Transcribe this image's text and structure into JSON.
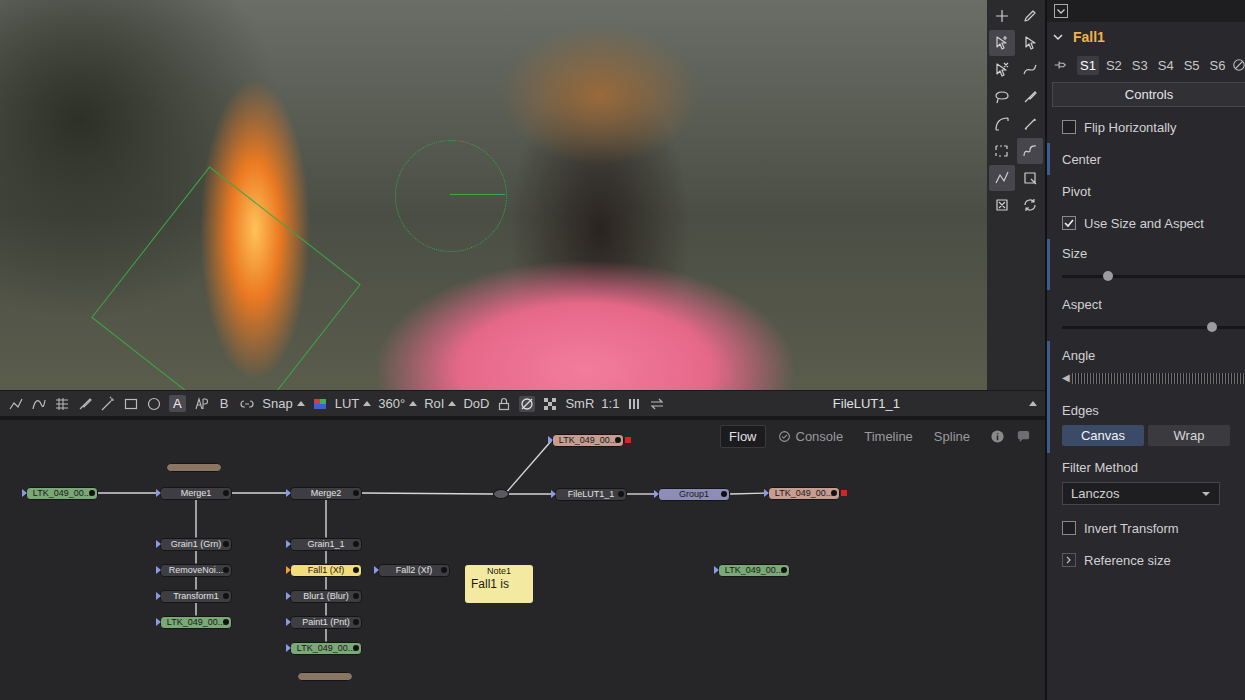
{
  "viewer_tools": [
    {
      "selected": false
    },
    {
      "selected": false
    },
    {
      "selected": true
    },
    {
      "selected": false
    },
    {
      "selected": false
    },
    {
      "selected": false
    },
    {
      "selected": false
    },
    {
      "selected": false
    },
    {
      "selected": false
    },
    {
      "selected": false
    },
    {
      "selected": false
    },
    {
      "selected": true
    },
    {
      "selected": true
    },
    {
      "selected": false
    },
    {
      "selected": false
    },
    {
      "selected": false
    }
  ],
  "viewer_toolbar": {
    "buffers": [
      {
        "label": "A",
        "selected": true
      },
      {
        "label": "B",
        "selected": false
      }
    ],
    "options_left": [
      {
        "label": "Snap",
        "dropdown": true
      }
    ],
    "options_mid": [
      {
        "label": "LUT",
        "dropdown": true
      },
      {
        "label": "360°",
        "dropdown": true
      },
      {
        "label": "RoI",
        "dropdown": true
      },
      {
        "label": "DoD",
        "dropdown": false
      }
    ],
    "options_right": [
      {
        "label": "SmR",
        "dropdown": false
      },
      {
        "label": "1:1",
        "dropdown": false
      }
    ],
    "view_name": "FileLUT1_1"
  },
  "node_editor": {
    "tabs": [
      {
        "label": "Flow",
        "selected": true
      },
      {
        "label": "Console",
        "selected": false
      },
      {
        "label": "Timeline",
        "selected": false
      },
      {
        "label": "Spline",
        "selected": false
      }
    ],
    "nodes": [
      {
        "label": "LTK_049_00...",
        "kind": "loader",
        "color": "#7aa877",
        "selected": false
      },
      {
        "label": "Merge1",
        "kind": "tool",
        "color": "#3e3e42",
        "selected": false
      },
      {
        "label": "Merge2",
        "kind": "tool",
        "color": "#3e3e42",
        "selected": false
      },
      {
        "kind": "dot",
        "color": "#5a5a5e",
        "selected": false
      },
      {
        "label": "LTK_049_00...",
        "kind": "saver",
        "color": "#c79c91",
        "selected": false
      },
      {
        "label": "FileLUT1_1",
        "kind": "tool",
        "color": "#3e3e42",
        "selected": false
      },
      {
        "label": "Group1",
        "kind": "group",
        "color": "#8d8db8",
        "selected": false
      },
      {
        "label": "LTK_049_00...",
        "kind": "saver",
        "color": "#c79c91",
        "selected": false
      },
      {
        "kind": "underlay",
        "color": "#8a7462",
        "selected": false
      },
      {
        "label": "Grain1 (Grn)",
        "kind": "tool",
        "color": "#3e3e42",
        "selected": false
      },
      {
        "label": "RemoveNoi...",
        "kind": "tool",
        "color": "#3e3e42",
        "selected": false
      },
      {
        "label": "Transform1",
        "kind": "tool",
        "color": "#3e3e42",
        "selected": false
      },
      {
        "label": "LTK_049_00...",
        "kind": "loader",
        "color": "#7aa877",
        "selected": false
      },
      {
        "label": "Grain1_1",
        "kind": "tool",
        "color": "#3e3e42",
        "selected": false
      },
      {
        "label": "Fall1 (Xf)",
        "kind": "tool",
        "color": "#3e3e42",
        "selected": true
      },
      {
        "label": "Blur1 (Blur)",
        "kind": "tool",
        "color": "#3e3e42",
        "selected": false
      },
      {
        "label": "Paint1 (Pnt)",
        "kind": "tool",
        "color": "#3e3e42",
        "selected": false
      },
      {
        "label": "LTK_049_00...",
        "kind": "loader",
        "color": "#7aa877",
        "selected": false
      },
      {
        "kind": "underlay",
        "color": "#8a7462",
        "selected": false
      },
      {
        "label": "Fall2 (Xf)",
        "kind": "tool",
        "color": "#3e3e42",
        "selected": false
      },
      {
        "label": "LTK_049_00...",
        "kind": "loader",
        "color": "#7aa877",
        "selected": false
      }
    ],
    "links": [
      [
        0,
        1
      ],
      [
        1,
        2
      ],
      [
        2,
        3
      ],
      [
        3,
        4
      ],
      [
        3,
        5
      ],
      [
        5,
        6
      ],
      [
        6,
        7
      ],
      [
        9,
        1
      ],
      [
        10,
        9
      ],
      [
        11,
        10
      ],
      [
        12,
        11
      ],
      [
        13,
        2
      ],
      [
        14,
        13
      ],
      [
        15,
        14
      ],
      [
        16,
        15
      ],
      [
        17,
        16
      ]
    ],
    "note": {
      "title": "Note1",
      "text": "Fall1 is"
    }
  },
  "inspector": {
    "tool": "Fall1",
    "expanded": true,
    "versions": [
      {
        "label": "S1",
        "selected": true
      },
      {
        "label": "S2",
        "selected": false
      },
      {
        "label": "S3",
        "selected": false
      },
      {
        "label": "S4",
        "selected": false
      },
      {
        "label": "S5",
        "selected": false
      },
      {
        "label": "S6",
        "selected": false
      }
    ],
    "tabs": [
      {
        "label": "Controls",
        "selected": true
      }
    ],
    "controls": [
      {
        "kind": "checkbox",
        "label": "Flip Horizontally",
        "checked": false,
        "marked": false
      },
      {
        "kind": "point",
        "label": "Center",
        "marked": true
      },
      {
        "kind": "point",
        "label": "Pivot",
        "marked": false
      },
      {
        "kind": "checkbox",
        "label": "Use Size and Aspect",
        "checked": true,
        "marked": false
      },
      {
        "kind": "slider",
        "label": "Size",
        "level": 0.23,
        "marked": true
      },
      {
        "kind": "slider",
        "label": "Aspect",
        "level": 0.75,
        "marked": false
      },
      {
        "kind": "dial",
        "label": "Angle",
        "arrow": "◀",
        "marked": true
      },
      {
        "kind": "buttons",
        "label": "Edges",
        "options": [
          {
            "label": "Canvas",
            "selected": true
          },
          {
            "label": "Wrap",
            "selected": false
          }
        ],
        "marked": true
      },
      {
        "kind": "dropdown",
        "label": "Filter Method",
        "value": "Lanczos",
        "marked": false
      },
      {
        "kind": "checkbox",
        "label": "Invert Transform",
        "checked": false,
        "marked": false
      },
      {
        "kind": "group",
        "label": "Reference size",
        "expanded": false,
        "marked": false
      }
    ]
  }
}
